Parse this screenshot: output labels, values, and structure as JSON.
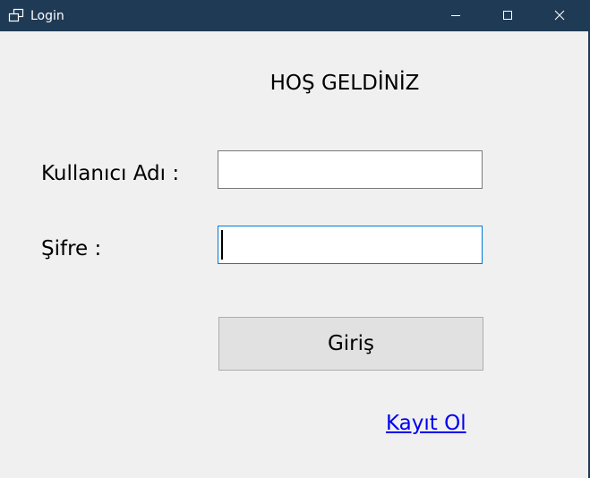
{
  "window": {
    "title": "Login"
  },
  "form": {
    "welcome": "HOŞ GELDİNİZ",
    "username_label": "Kullanıcı Adı :",
    "username_value": "",
    "password_label": "Şifre :",
    "password_value": "",
    "login_button": "Giriş",
    "register_link": "Kayıt Ol"
  },
  "colors": {
    "titlebar": "#1f3a55",
    "window_bg": "#f0f0f0",
    "focus_border": "#0078d7",
    "link": "#0000ee"
  },
  "icons": {
    "app": "window-cascade-icon",
    "minimize": "minimize-icon",
    "maximize": "maximize-icon",
    "close": "close-icon"
  }
}
